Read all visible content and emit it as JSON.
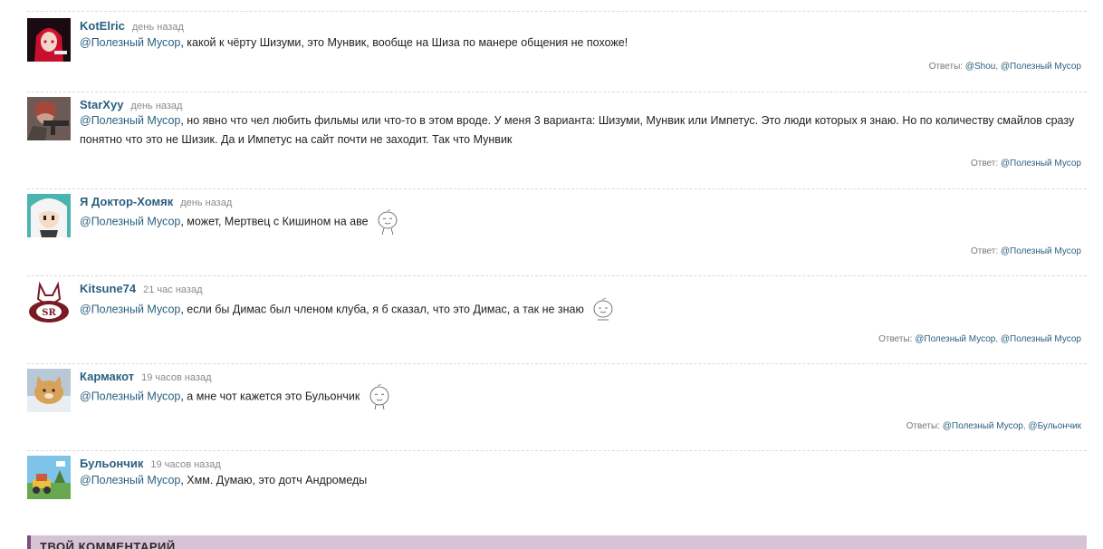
{
  "comments": [
    {
      "author": "KotElric",
      "time": "день назад",
      "mention": "@Полезный Мусор",
      "text": ", какой к чёрту Шизуми, это Мунвик, вообще на Шиза по манере общения не похоже!",
      "replies_label": "Ответы:",
      "replies": [
        "@Shou",
        "@Полезный Мусор"
      ]
    },
    {
      "author": "StarXyy",
      "time": "день назад",
      "mention": "@Полезный Мусор",
      "text": ", но явно что чел любить фильмы или что-то в этом вроде. У меня 3 варианта: Шизуми, Мунвик или Импетус. Это люди которых я знаю. Но по количеству смайлов сразу понятно что это не Шизик. Да и Импетус на сайт почти не заходит. Так что Мунвик",
      "replies_label": "Ответ:",
      "replies": [
        "@Полезный Мусор"
      ]
    },
    {
      "author": "Я Доктор-Хомяк",
      "time": "день назад",
      "mention": "@Полезный Мусор",
      "text": ", может, Мертвец с Кишином на аве",
      "replies_label": "Ответ:",
      "replies": [
        "@Полезный Мусор"
      ]
    },
    {
      "author": "Kitsune74",
      "time": "21 час назад",
      "mention": "@Полезный Мусор",
      "text": ", если бы Димас был членом клуба, я б сказал, что это Димас, а так не знаю",
      "replies_label": "Ответы:",
      "replies": [
        "@Полезный Мусор",
        "@Полезный Мусор"
      ]
    },
    {
      "author": "Кармакот",
      "time": "19 часов назад",
      "mention": "@Полезный Мусор",
      "text": ", а мне чот кажется это Бульончик",
      "replies_label": "Ответы:",
      "replies": [
        "@Полезный Мусор",
        "@Бульончик"
      ]
    },
    {
      "author": "Бульончик",
      "time": "19 часов назад",
      "mention": "@Полезный Мусор",
      "text": ", Хмм. Думаю, это дотч Андромеды"
    }
  ],
  "comment_form": {
    "title": "ТВОЙ КОММЕНТАРИЙ"
  },
  "colors": {
    "link": "#2b6081",
    "form_bar": "#d6c3d5",
    "form_accent": "#7d4e7b"
  }
}
